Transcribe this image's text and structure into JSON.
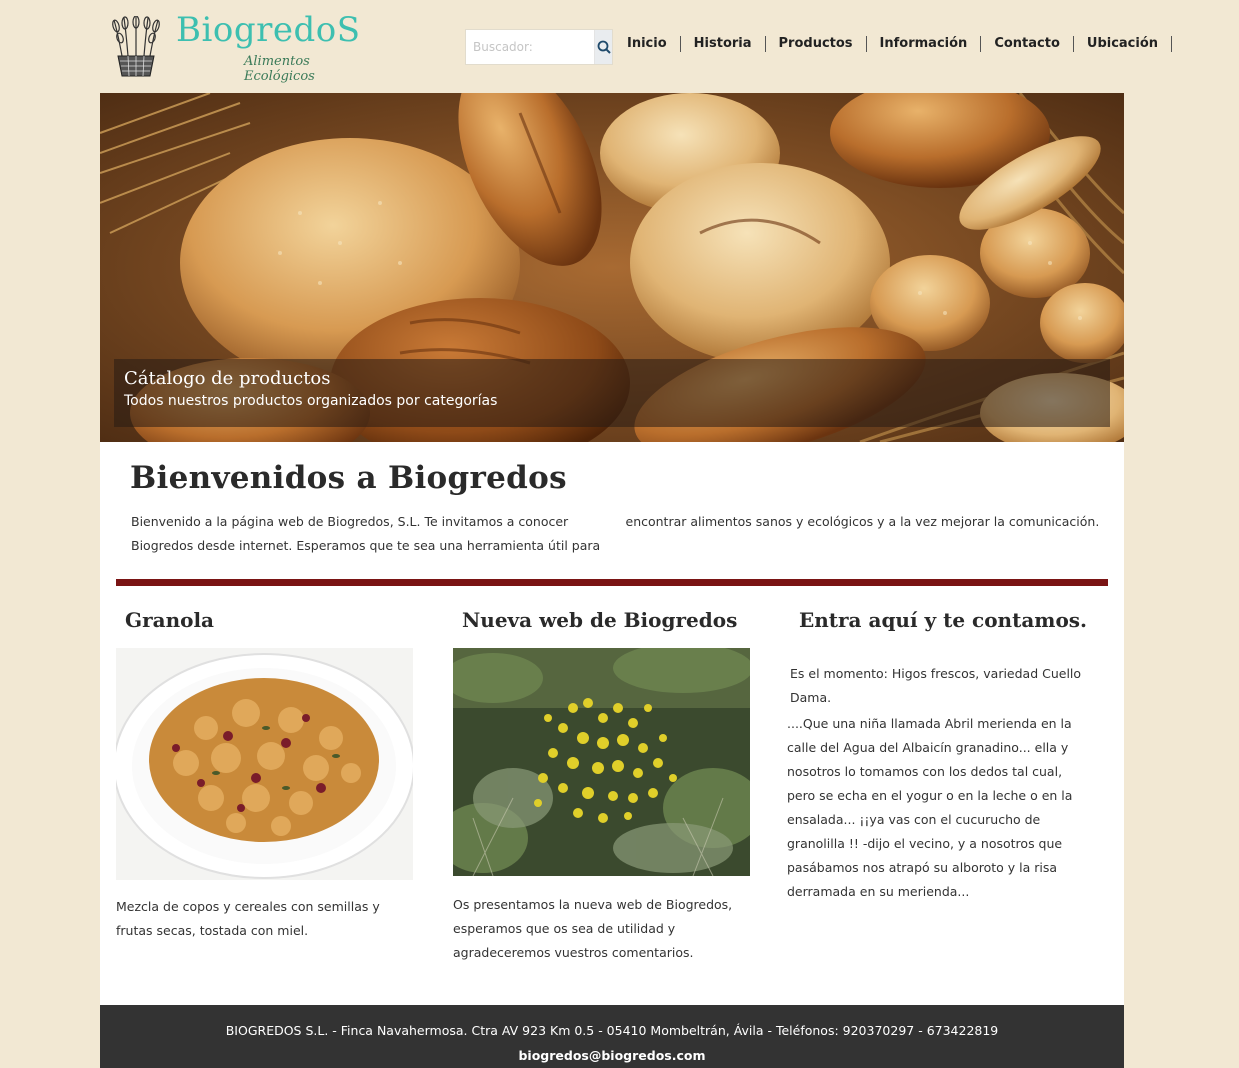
{
  "header": {
    "logo_title": "BiogredoS",
    "logo_subtitle": "Alimentos Ecológicos",
    "search_placeholder": "Buscador:",
    "nav": [
      "Inicio",
      "Historia",
      "Productos",
      "Información",
      "Contacto",
      "Ubicación"
    ]
  },
  "hero": {
    "caption_title": "Cátalogo de productos",
    "caption_subtitle": "Todos nuestros productos organizados por categorías"
  },
  "welcome": {
    "title": "Bienvenidos a Biogredos",
    "text": "Bienvenido a la página web de Biogredos, S.L. Te invitamos a conocer Biogredos desde internet. Esperamos que te sea una herramienta útil para encontrar alimentos sanos y ecológicos y a la vez mejorar la comunicación."
  },
  "columns": [
    {
      "title": "Granola",
      "text": "Mezcla de copos y cereales con semillas y frutas secas, tostada con miel."
    },
    {
      "title": "Nueva web de Biogredos",
      "text": "Os presentamos la nueva web de Biogredos, esperamos que os sea de utilidad y agradeceremos vuestros comentarios."
    },
    {
      "title": "Entra aquí y te contamos.",
      "text_intro": "Es el momento: Higos frescos, variedad Cuello Dama.",
      "text": "....Que una niña llamada Abril merienda en la calle del Agua del Albaicín granadino... ella y nosotros lo tomamos con los dedos tal cual, pero se echa en el yogur o en la leche o en la ensalada... ¡¡ya vas con el cucurucho de granolilla !! -dijo el vecino, y a nosotros que pasábamos nos atrapó su alboroto y la risa derramada en su merienda..."
    }
  ],
  "footer": {
    "address": "BIOGREDOS S.L. - Finca Navahermosa. Ctra AV 923 Km 0.5 - 05410 Mombeltrán, Ávila - Teléfonos: 920370297  -  673422819",
    "email": "biogredos@biogredos.com"
  },
  "colors": {
    "background": "#f2e8d3",
    "logo_teal": "#3dbfb0",
    "divider": "#7a1414",
    "footer": "#333333"
  },
  "icons": {
    "search_button": "search-icon",
    "logo": "wheat-basket-icon"
  }
}
